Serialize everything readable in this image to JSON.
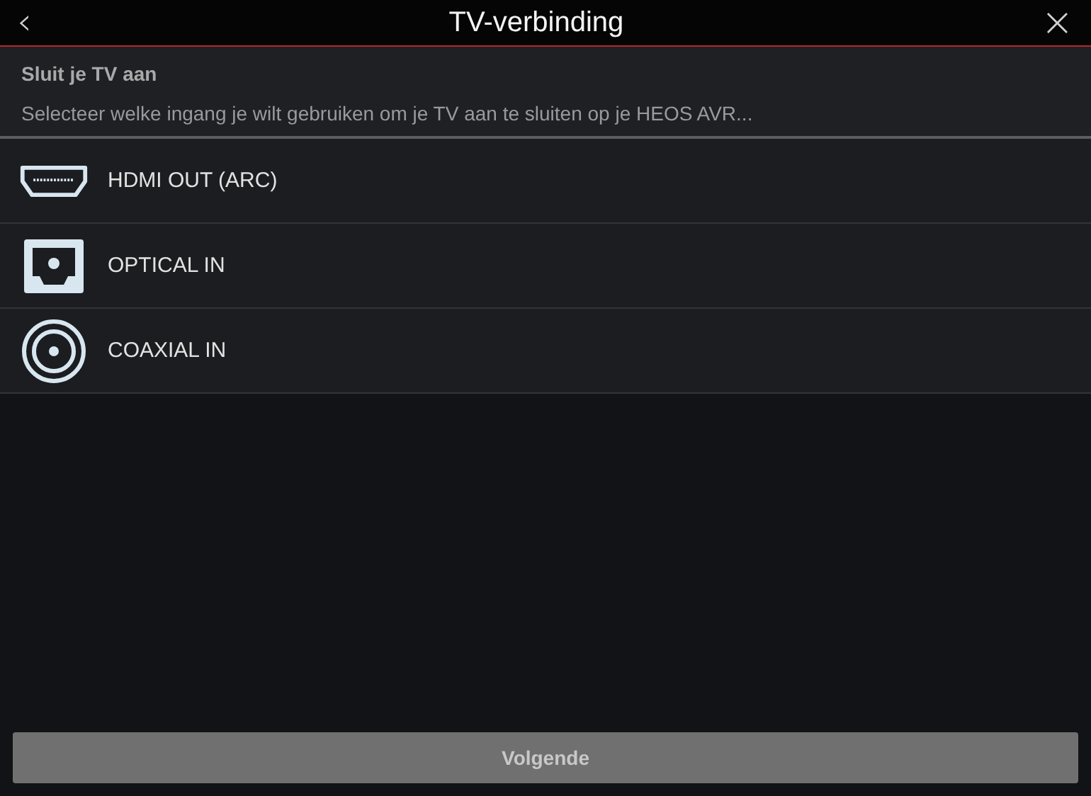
{
  "header": {
    "back": "‹",
    "title": "TV-verbinding",
    "close": "×"
  },
  "intro": {
    "heading": "Sluit je TV aan",
    "text": "Selecteer welke ingang je wilt gebruiken om je TV aan te sluiten op je HEOS AVR..."
  },
  "inputs": [
    {
      "kind": "hdmi",
      "label": "HDMI OUT (ARC)"
    },
    {
      "kind": "optical",
      "label": "OPTICAL IN"
    },
    {
      "kind": "coaxial",
      "label": "COAXIAL IN"
    }
  ],
  "next_button": {
    "label": "Volgende",
    "disabled": true
  }
}
